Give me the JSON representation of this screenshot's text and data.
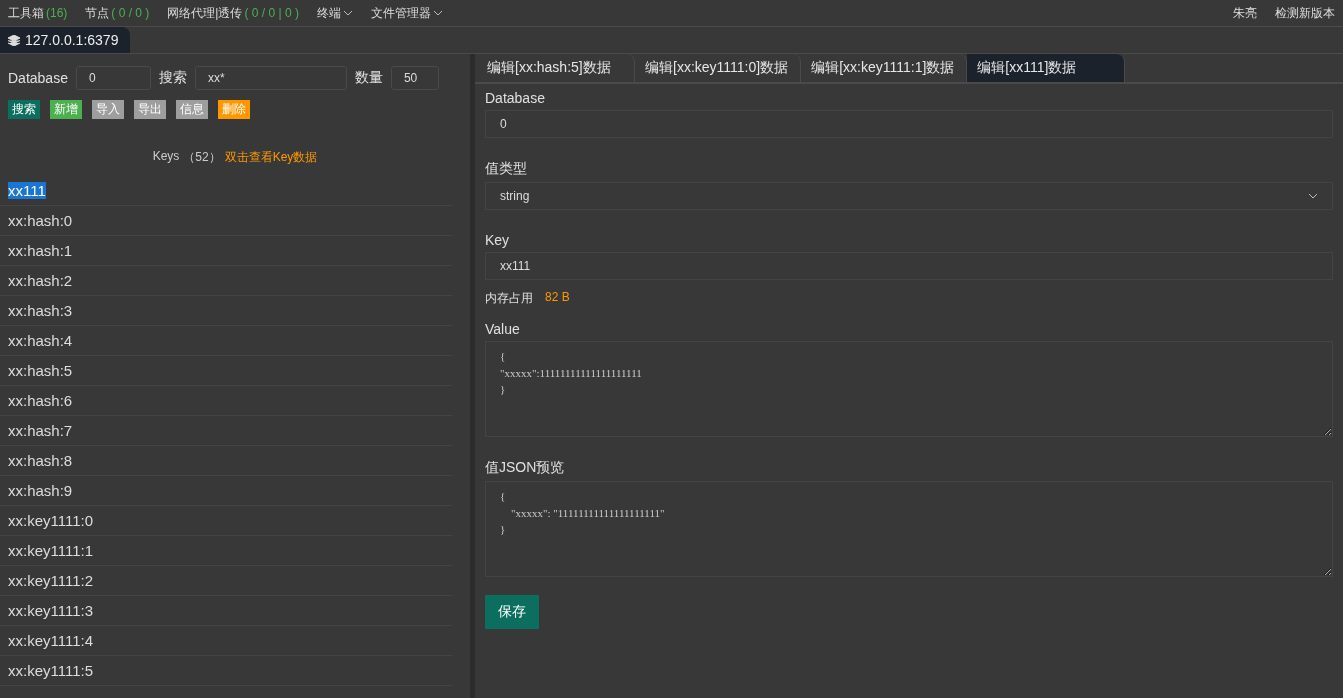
{
  "menu": [
    {
      "label": "工具箱",
      "count": "(16)",
      "dropdown": false
    },
    {
      "label": "节点",
      "count": "( 0 / 0 )",
      "dropdown": false
    },
    {
      "label": "网络代理|透传",
      "count": "( 0 / 0 | 0 )",
      "dropdown": false
    },
    {
      "label": "终端",
      "dropdown": true
    },
    {
      "label": "文件管理器",
      "dropdown": true
    }
  ],
  "menu_right": [
    "朱亮",
    "检测新版本"
  ],
  "connection_tab": {
    "label": "127.0.0.1:6379",
    "selected": true
  },
  "search_form": {
    "database_label": "Database",
    "database": "0",
    "search_label": "搜索",
    "search": "xx*",
    "count_label": "数量",
    "count": "50"
  },
  "actions": [
    {
      "label": "搜索",
      "kind": "primary"
    },
    {
      "label": "新增",
      "kind": "success"
    },
    {
      "label": "导入",
      "kind": "neutral"
    },
    {
      "label": "导出",
      "kind": "neutral"
    },
    {
      "label": "信息",
      "kind": "neutral"
    },
    {
      "label": "删除",
      "kind": "warning"
    }
  ],
  "keys_header": {
    "label": "Keys",
    "count": "（52）",
    "hint": "双击查看Key数据"
  },
  "keys": [
    {
      "name": "xx111",
      "selected": true
    },
    {
      "name": "xx:hash:0",
      "selected": false
    },
    {
      "name": "xx:hash:1",
      "selected": false
    },
    {
      "name": "xx:hash:2",
      "selected": false
    },
    {
      "name": "xx:hash:3",
      "selected": false
    },
    {
      "name": "xx:hash:4",
      "selected": false
    },
    {
      "name": "xx:hash:5",
      "selected": false
    },
    {
      "name": "xx:hash:6",
      "selected": false
    },
    {
      "name": "xx:hash:7",
      "selected": false
    },
    {
      "name": "xx:hash:8",
      "selected": false
    },
    {
      "name": "xx:hash:9",
      "selected": false
    },
    {
      "name": "xx:key1111:0",
      "selected": false
    },
    {
      "name": "xx:key1111:1",
      "selected": false
    },
    {
      "name": "xx:key1111:2",
      "selected": false
    },
    {
      "name": "xx:key1111:3",
      "selected": false
    },
    {
      "name": "xx:key1111:4",
      "selected": false
    },
    {
      "name": "xx:key1111:5",
      "selected": false
    }
  ],
  "editor_tabs": [
    {
      "label": "编辑[xx:hash:5]数据",
      "selected": false
    },
    {
      "label": "编辑[xx:key1111:0]数据",
      "selected": false
    },
    {
      "label": "编辑[xx:key1111:1]数据",
      "selected": false
    },
    {
      "label": "编辑[xx111]数据",
      "selected": true
    }
  ],
  "editor": {
    "database_label": "Database",
    "database": "0",
    "type_label": "值类型",
    "type": "string",
    "key_label": "Key",
    "key": "xx111",
    "memory_label": "内存占用",
    "memory": "82  B",
    "value_label": "Value",
    "value": "{\n\"xxxxx\":11111111111111111111\n}",
    "preview_label": "值JSON预览",
    "preview": "{\n    \"xxxxx\": \"11111111111111111111\"\n}",
    "save": "保存"
  }
}
